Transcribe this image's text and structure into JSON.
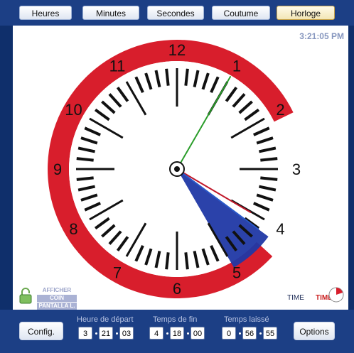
{
  "tabs": [
    {
      "label": "Heures"
    },
    {
      "label": "Minutes"
    },
    {
      "label": "Secondes"
    },
    {
      "label": "Coutume"
    },
    {
      "label": "Horloge",
      "active": true
    }
  ],
  "digital_time": "3:21:05 PM",
  "dial_numbers": [
    "12",
    "1",
    "2",
    "3",
    "4",
    "5",
    "6",
    "7",
    "8",
    "9",
    "10",
    "11"
  ],
  "clock": {
    "hours": 3,
    "minutes": 21,
    "seconds": 5,
    "remaining_end_minute": 18,
    "ring_color": "#d81e2c",
    "wedge_color": "#2038a5",
    "second_hand_color": "#2a9d2a",
    "hour_hand_color": "#c0182a",
    "minute_hand_color": "#2a58c8"
  },
  "lock_label": {
    "line1": "AFFICHER",
    "line2": "COIN",
    "line3": "PANTALLA L."
  },
  "brand": {
    "part1": "TIME",
    "part2": "TIMER"
  },
  "bottom": {
    "config_label": "Config.",
    "options_label": "Options",
    "start_label": "Heure de départ",
    "end_label": "Temps de fin",
    "left_label": "Temps laissé",
    "start": [
      "3",
      "21",
      "03"
    ],
    "end": [
      "4",
      "18",
      "00"
    ],
    "left": [
      "0",
      "56",
      "55"
    ]
  }
}
